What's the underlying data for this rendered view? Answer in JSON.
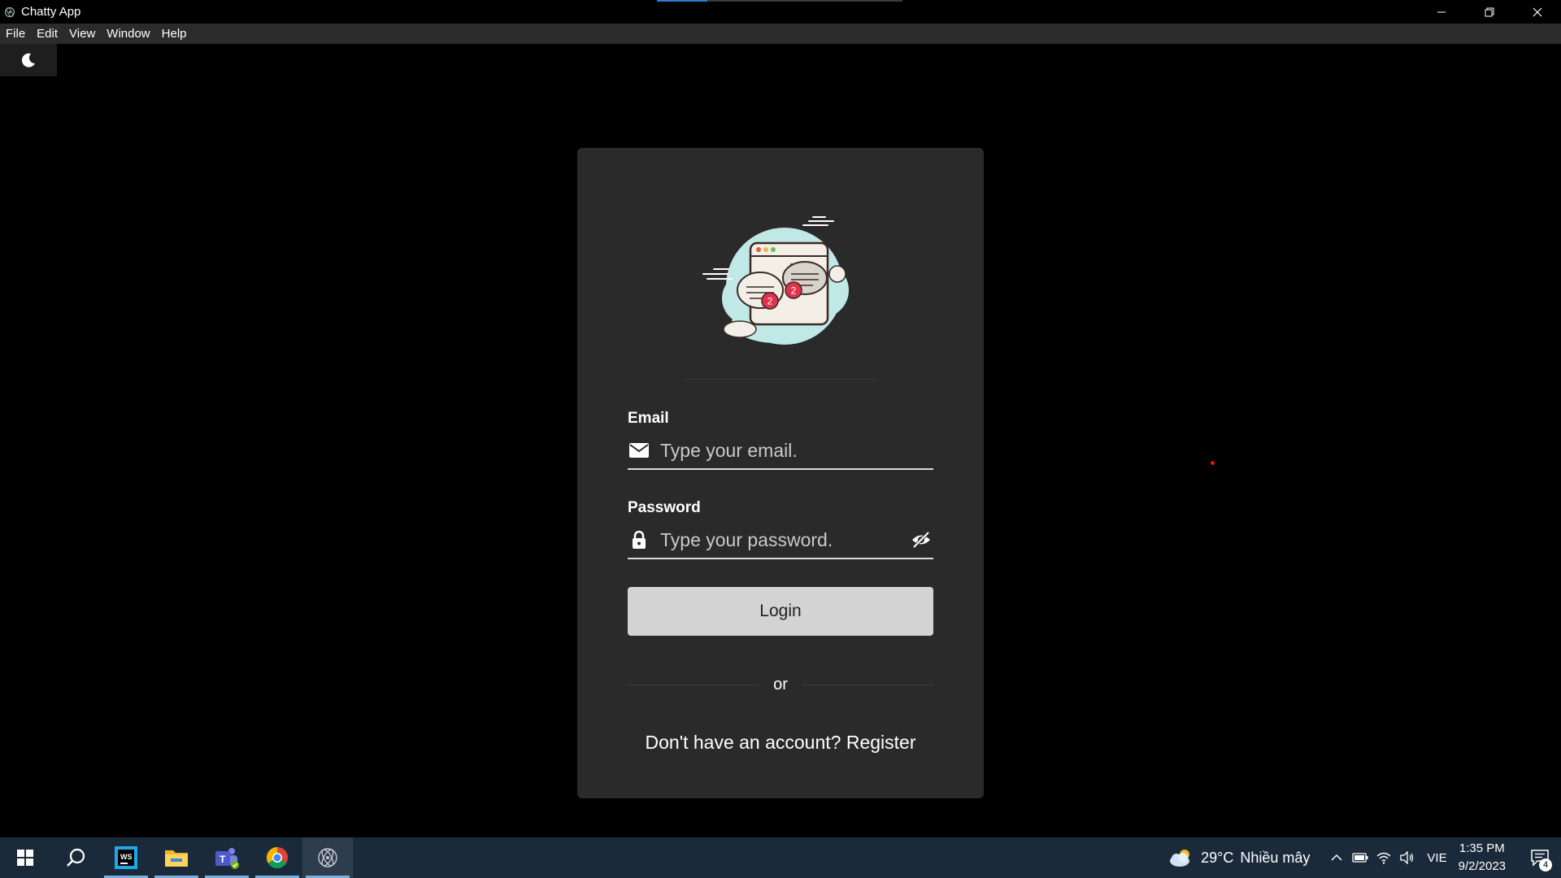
{
  "window": {
    "title": "Chatty App",
    "controls": [
      "minimize",
      "restore",
      "close"
    ]
  },
  "menu": {
    "items": [
      "File",
      "Edit",
      "View",
      "Window",
      "Help"
    ]
  },
  "theme_toggle": {
    "icon": "moon-icon"
  },
  "login": {
    "illustration": "chat-cloud-illustration",
    "email": {
      "label": "Email",
      "placeholder": "Type your email.",
      "icon": "mail-icon"
    },
    "password": {
      "label": "Password",
      "placeholder": "Type your password.",
      "icon": "lock-icon",
      "toggle_icon": "eye-off-icon"
    },
    "login_button": "Login",
    "divider_text": "or",
    "register_text": "Don't have an account? Register",
    "badges": [
      "2",
      "2"
    ]
  },
  "taskbar": {
    "apps": [
      "start",
      "search",
      "webstorm",
      "file-explorer",
      "teams",
      "chrome",
      "electron-app"
    ],
    "weather": {
      "temp": "29°C",
      "desc": "Nhiều mây"
    },
    "language": "VIE",
    "time": "1:35 PM",
    "date": "9/2/2023",
    "notification_count": "4"
  },
  "colors": {
    "background": "#000000",
    "card": "#2a2a2a",
    "menubar": "#2b2b2b",
    "button": "#d3d3d3",
    "taskbar": "#1b2a3a",
    "badge_red": "#e0334b",
    "cloud": "#bfe8e6"
  }
}
